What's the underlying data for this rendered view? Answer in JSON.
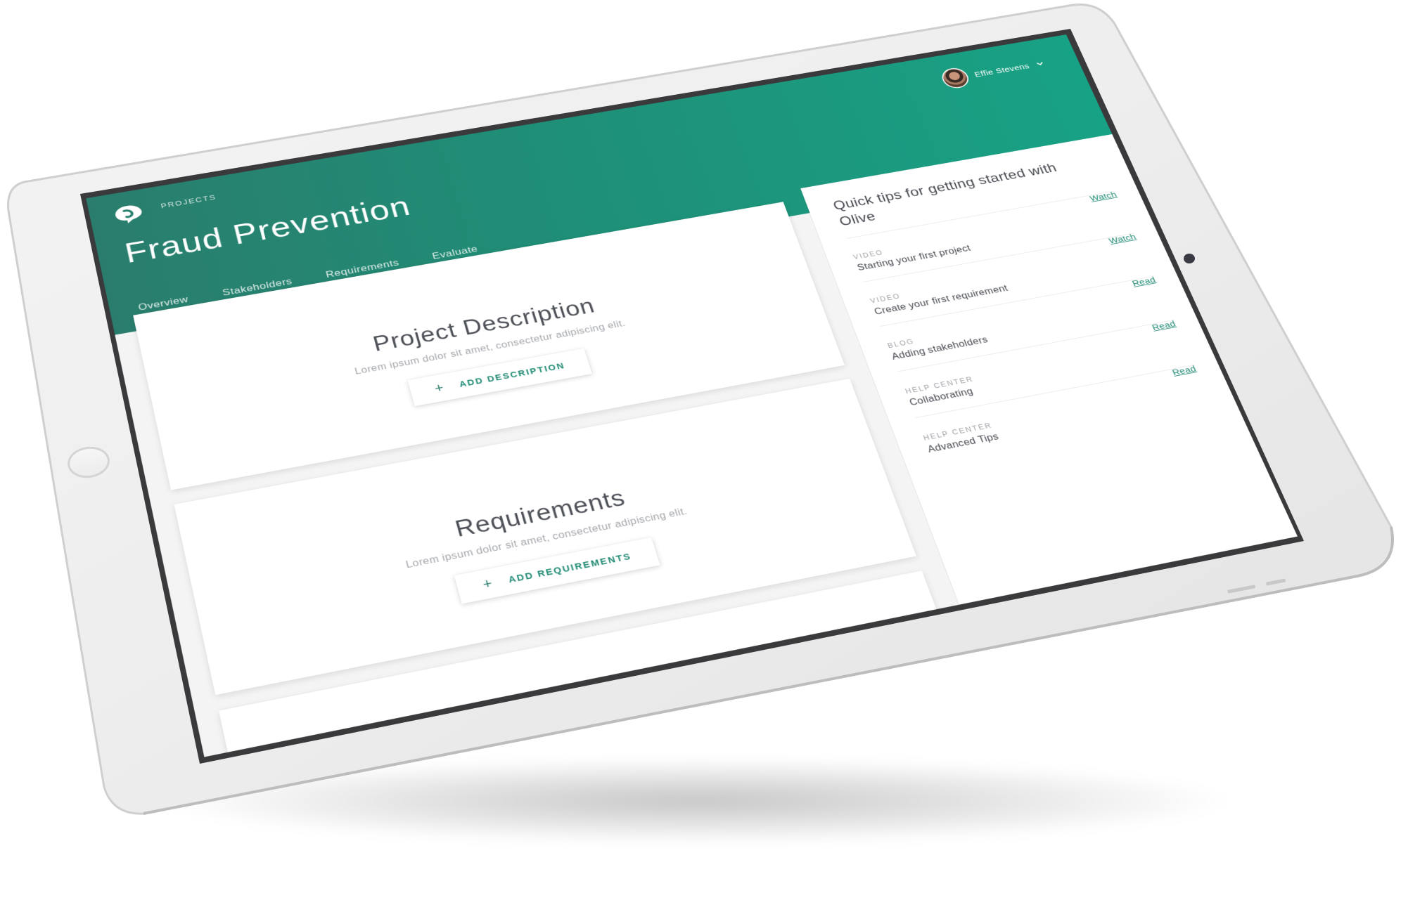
{
  "app": {
    "breadcrumb": "PROJECTS",
    "title": "Fraud Prevention",
    "tabs": [
      {
        "label": "Overview",
        "active": true
      },
      {
        "label": "Stakeholders",
        "active": false
      },
      {
        "label": "Requirements",
        "active": false
      },
      {
        "label": "Evaluate",
        "active": false
      }
    ],
    "user": {
      "name": "Effie Stevens"
    }
  },
  "cards": [
    {
      "title": "Project Description",
      "text": "Lorem ipsum dolor sit amet, consectetur adipiscing elit.",
      "button": "ADD DESCRIPTION"
    },
    {
      "title": "Requirements",
      "text": "Lorem ipsum dolor sit amet, consectetur adipiscing elit.",
      "button": "ADD REQUIREMENTS"
    }
  ],
  "tips": {
    "title": "Quick tips for getting started with Olive",
    "items": [
      {
        "type": "VIDEO",
        "label": "Starting your first project",
        "link": "Watch"
      },
      {
        "type": "VIDEO",
        "label": "Create your first requirement",
        "link": "Watch"
      },
      {
        "type": "BLOG",
        "label": "Adding stakeholders",
        "link": "Read"
      },
      {
        "type": "HELP CENTER",
        "label": "Collaborating",
        "link": "Read"
      },
      {
        "type": "HELP CENTER",
        "label": "Advanced Tips",
        "link": "Read"
      }
    ]
  },
  "colors": {
    "brand": "#1f8f77",
    "accent": "#1e8a73",
    "device": "#f0f0f0",
    "bezel": "#3a3a3c"
  },
  "icons": {
    "logo": "olive-logo-icon",
    "chevron": "chevron-down-icon",
    "plus": "plus-icon"
  }
}
